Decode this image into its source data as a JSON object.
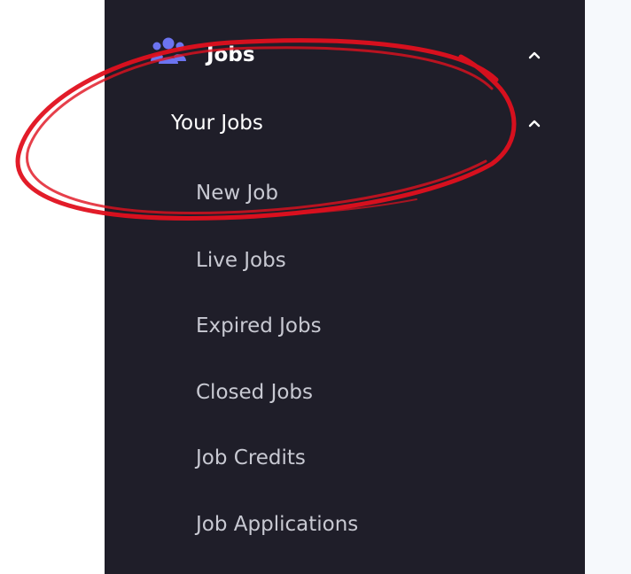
{
  "sidebar": {
    "section": {
      "label": "Jobs",
      "icon": "users-icon",
      "chevron": "chevron-up-icon"
    },
    "subsection": {
      "label": "Your Jobs",
      "chevron": "chevron-up-icon"
    },
    "items": [
      {
        "label": "New Job"
      },
      {
        "label": "Live Jobs"
      },
      {
        "label": "Expired Jobs"
      },
      {
        "label": "Closed Jobs"
      },
      {
        "label": "Job Credits"
      },
      {
        "label": "Job Applications"
      }
    ]
  },
  "colors": {
    "sidebar_bg": "#1f1e29",
    "icon_accent": "#6c74f0",
    "annotation": "#e0101e",
    "item_text": "#c8c9d2",
    "active_text": "#ffffff"
  }
}
